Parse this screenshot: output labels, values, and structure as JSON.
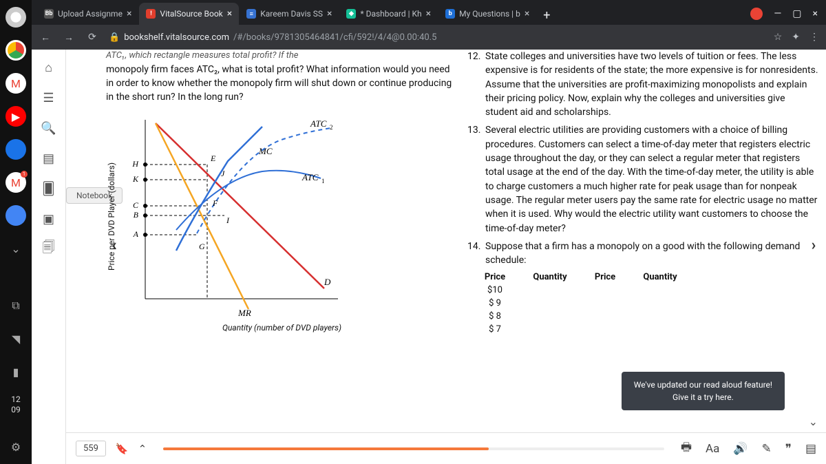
{
  "dock": {
    "time_hh": "12",
    "time_mm": "09"
  },
  "tabs": [
    {
      "favicon_bg": "#555",
      "favicon_fg": "#fff",
      "favicon_txt": "Bb",
      "label": "Upload Assignme"
    },
    {
      "favicon_bg": "#e03e2d",
      "favicon_fg": "#fff",
      "favicon_txt": "!",
      "label": "VitalSource Book",
      "active": true
    },
    {
      "favicon_bg": "#3672d1",
      "favicon_fg": "#fff",
      "favicon_txt": "≡",
      "label": "Kareem Davis SS"
    },
    {
      "favicon_bg": "#14bf96",
      "favicon_fg": "#fff",
      "favicon_txt": "◆",
      "label": "* Dashboard | Kh"
    },
    {
      "favicon_bg": "#1e6fd6",
      "favicon_fg": "#fff",
      "favicon_txt": "b",
      "label": "My Questions | b"
    }
  ],
  "addressbar": {
    "host": "bookshelf.vitalsource.com",
    "path": "/#/books/9781305464841/cfi/592!/4/4@0.00:40.5"
  },
  "vs_rail": {
    "notebook_label": "Notebook"
  },
  "left_col": {
    "fragment_top": "ATC₁, which rectangle measures total profit? If the",
    "q_text": "monopoly firm faces ATC₂, what is total profit? What information would you need in order to know whether the monopoly firm will shut down or continue producing in the short run? In the long run?",
    "y_axis": "Price per DVD Player (dollars)",
    "x_axis": "Quantity (number of DVD players)"
  },
  "right_col": {
    "q12_num": "12.",
    "q12": "State colleges and universities have two levels of tuition or fees. The less expensive is for residents of the state; the more expensive is for nonresidents. Assume that the universities are profit-maximizing monopolists and explain their pricing policy. Now, explain why the colleges and universities give student aid and scholarships.",
    "q13_num": "13.",
    "q13": "Several electric utilities are providing customers with a choice of billing procedures. Customers can select a time-of-day meter that registers electric usage throughout the day, or they can select a regular meter that registers total usage at the end of the day. With the time-of-day meter, the utility is able to charge customers a much higher rate for peak usage than for nonpeak usage. The regular meter users pay the same rate for electric usage no matter when it is used. Why would the electric utility want customers to choose the time-of-day meter?",
    "q14_num": "14.",
    "q14": "Suppose that a firm has a monopoly on a good with the following demand schedule:",
    "table": {
      "h1": "Price",
      "h2": "Quantity",
      "h3": "Price",
      "h4": "Quantity",
      "r1c1": "$10",
      "r2c1": "$ 9",
      "r3c1": "$ 8",
      "r4c1": "$ 7"
    }
  },
  "toast": {
    "line1": "We've updated our read aloud feature!",
    "line2": "Give it a try here."
  },
  "bottombar": {
    "page": "559"
  },
  "chart_data": {
    "type": "line",
    "title": "",
    "xlabel": "Quantity (number of DVD players)",
    "ylabel": "Price per DVD Player (dollars)",
    "y_ticks": [
      "H",
      "K",
      "C",
      "B",
      "A"
    ],
    "series": [
      {
        "name": "Demand (D)",
        "color": "#d62f2f"
      },
      {
        "name": "MR",
        "color": "#f5a623"
      },
      {
        "name": "MC",
        "color": "#2f6fd6"
      },
      {
        "name": "ATC₁",
        "color": "#2f6fd6",
        "style": "solid"
      },
      {
        "name": "ATC₂",
        "color": "#2f6fd6",
        "style": "dashed"
      }
    ],
    "point_labels": [
      "E",
      "J",
      "F",
      "I",
      "G"
    ],
    "curve_labels": [
      "ATC₂",
      "MC",
      "ATC₁",
      "D",
      "MR"
    ]
  }
}
